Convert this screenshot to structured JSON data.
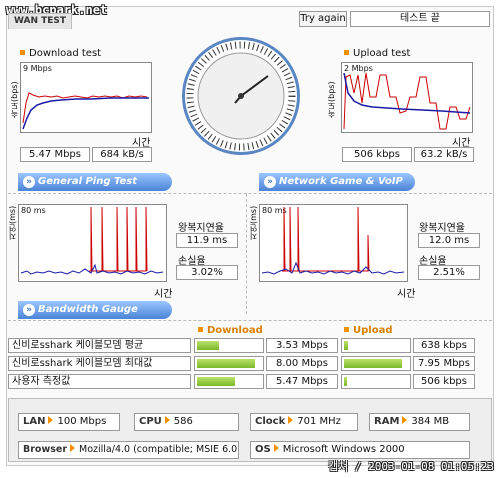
{
  "watermark_top": "www.bcpark.net",
  "watermark_bottom": "캡쳐 / 2003-01-08 01:05:23",
  "tab": "WAN TEST",
  "try_again": "Try again",
  "status": "테스트 끝",
  "download": {
    "title": "Download test",
    "ylabel": "속도(bps)",
    "ymax": "9 Mbps",
    "xlabel": "시간",
    "value_bps": "5.47 Mbps",
    "value_bytes": "684 kB/s"
  },
  "upload": {
    "title": "Upload test",
    "ylabel": "속도(bps)",
    "ymax": "2 Mbps",
    "xlabel": "시간",
    "value_bps": "506 kbps",
    "value_bytes": "63.2 kB/s"
  },
  "ping": {
    "title": "General Ping Test",
    "ylabel": "지연(ms)",
    "ymax": "80 ms",
    "xlabel": "시간",
    "rtt_label": "왕복지연율",
    "rtt": "11.9 ms",
    "loss_label": "손실율",
    "loss": "3.02%"
  },
  "game": {
    "title": "Network Game & VoIP Test",
    "ylabel": "지연(ms)",
    "ymax": "80 ms",
    "xlabel": "시간",
    "rtt_label": "왕복지연율",
    "rtt": "12.0 ms",
    "loss_label": "손실율",
    "loss": "2.51%"
  },
  "gauge": {
    "title": "Bandwidth Gauge",
    "download_header": "Download",
    "upload_header": "Upload",
    "rows": [
      {
        "label": "신비로sshark 케이블모뎀 평균",
        "down": "3.53 Mbps",
        "down_frac": 0.35,
        "up": "638 kbps",
        "up_frac": 0.07
      },
      {
        "label": "신비로sshark 케이블모뎀 최대값",
        "down": "8.00 Mbps",
        "down_frac": 0.9,
        "up": "7.95 Mbps",
        "up_frac": 0.9
      },
      {
        "label": "사용자 측정값",
        "down": "5.47 Mbps",
        "down_frac": 0.6,
        "up": "506 kbps",
        "up_frac": 0.05
      }
    ]
  },
  "sysinfo": {
    "lan_label": "LAN",
    "lan": "100 Mbps",
    "cpu_label": "CPU",
    "cpu": "586",
    "clock_label": "Clock",
    "clock": "701 MHz",
    "ram_label": "RAM",
    "ram": "384 MB",
    "browser_label": "Browser",
    "browser": "Mozilla/4.0 (compatible; MSIE 6.0",
    "os_label": "OS",
    "os": "Microsoft Windows 2000"
  },
  "colors": {
    "accent": "#f29100",
    "section": "#4a83d6",
    "line_red": "#cc0000",
    "line_blue": "#1a1aa8"
  }
}
